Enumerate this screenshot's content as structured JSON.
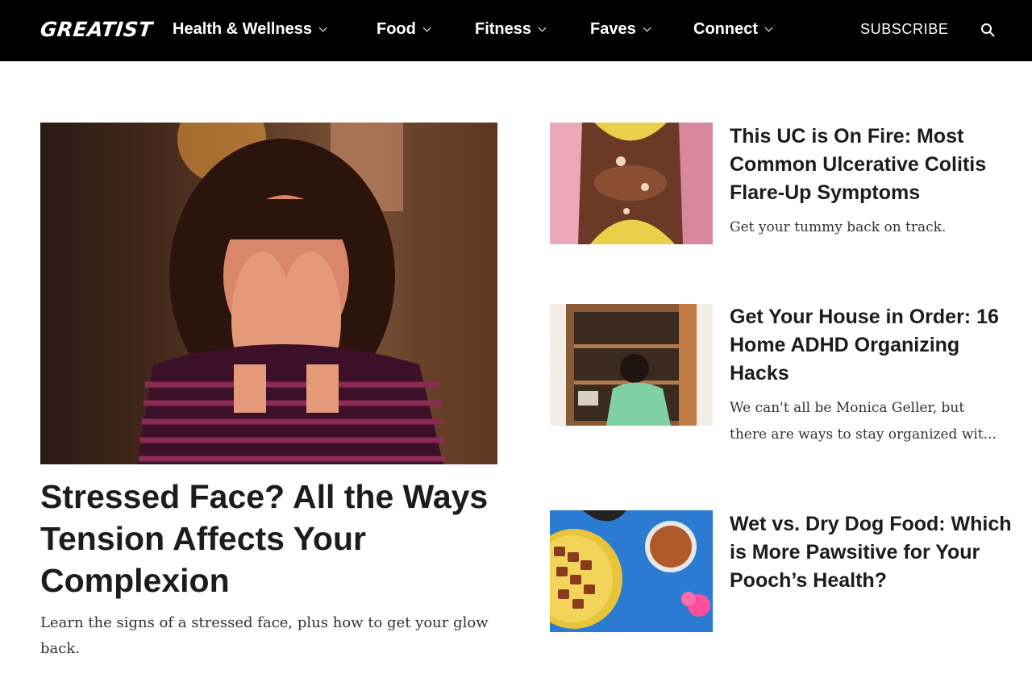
{
  "header": {
    "logo": "GREATIST",
    "nav": [
      {
        "label": "Health & Wellness"
      },
      {
        "label": "Food"
      },
      {
        "label": "Fitness"
      },
      {
        "label": "Faves"
      },
      {
        "label": "Connect"
      }
    ],
    "subscribe": "SUBSCRIBE"
  },
  "hero": {
    "title": "Stressed Face? All the Ways Tension Affects Your Complexion",
    "subtitle": "Learn the signs of a stressed face, plus how to get your glow back."
  },
  "cards": [
    {
      "title": "This UC is On Fire: Most Common Ulcerative Colitis Flare-Up Symptoms",
      "subtitle": "Get your tummy back on track."
    },
    {
      "title": "Get Your House in Order: 16 Home ADHD Organizing Hacks",
      "subtitle_line1": "We can't all be Monica Geller, but",
      "subtitle_line2": "there are ways to stay organized wit..."
    },
    {
      "title": "Wet vs. Dry Dog Food: Which is More Pawsitive for Your Pooch’s Health?"
    }
  ]
}
